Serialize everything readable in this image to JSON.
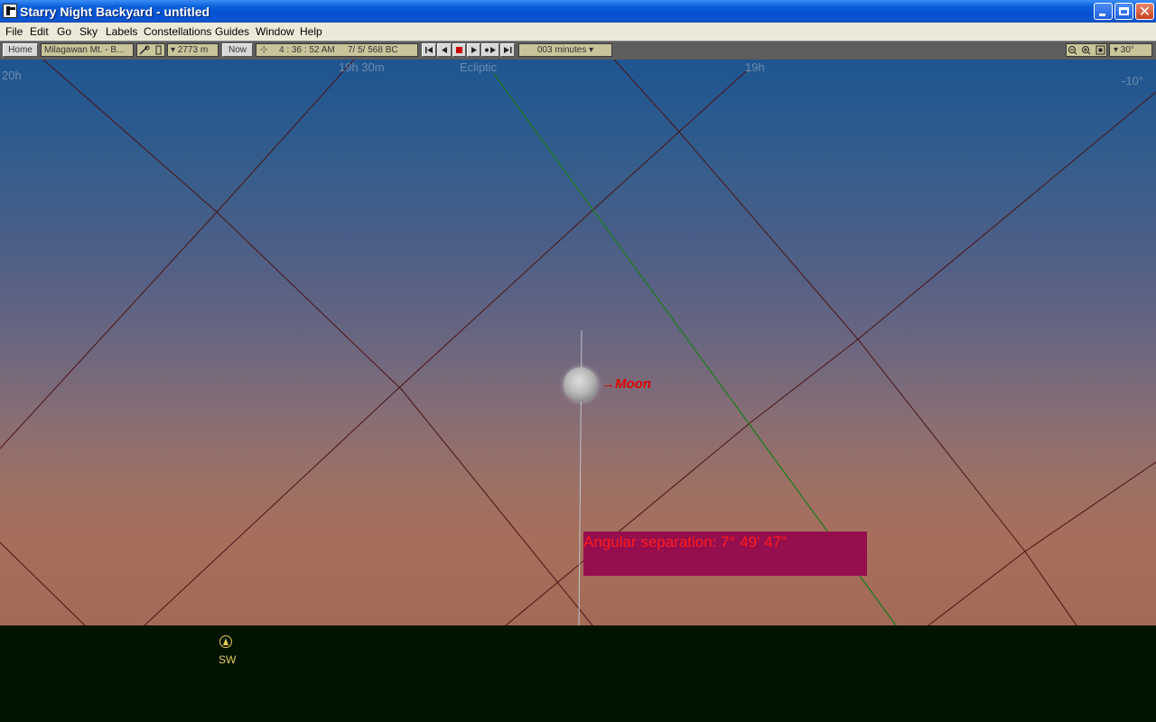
{
  "window": {
    "title": "Starry Night Backyard - untitled",
    "close_glyph": "✕"
  },
  "menu": {
    "items": [
      "File",
      "Edit",
      "Go",
      "Sky",
      "Labels",
      "Constellations",
      "Guides",
      "Window",
      "Help"
    ]
  },
  "toolbar": {
    "home_label": "Home",
    "location": "Milagawan Mt. - B...",
    "elevation": "▾ 2773 m",
    "now_label": "Now",
    "time": "4 : 36 : 52 AM",
    "date": "7/  5/  568 BC",
    "time_step": "003 minutes ▾",
    "field_of_view": "▾ 30°",
    "icons": [
      "location-tools-icon",
      "rewind-icon",
      "step-back-icon",
      "stop-icon",
      "play-icon",
      "step-forward-icon",
      "fast-forward-icon",
      "zoom-out-icon",
      "zoom-in-icon",
      "fit-view-icon"
    ]
  },
  "sky": {
    "grid_labels": {
      "ra_20h": "20h",
      "ra_19h30m": "19h 30m",
      "ecliptic": "Ecliptic",
      "ra_19h": "19h",
      "dec_minus10": "-10°"
    },
    "moon_label": "→Moon",
    "angular_separation": "Angular separation: 7° 49' 47\""
  },
  "ground": {
    "compass_label": "SW"
  },
  "colors": {
    "title_bar": "#0a5fd8",
    "menu_bar": "#ece9d8",
    "toolbar": "#5e5e5e",
    "grid_lines": "#4a1414",
    "ecliptic_line": "#1f7a1f",
    "moon_label": "#e00000",
    "separation_box": "#950f4f",
    "separation_text": "#ff1a1a",
    "ground": "#001400",
    "compass": "#e6c85a"
  }
}
